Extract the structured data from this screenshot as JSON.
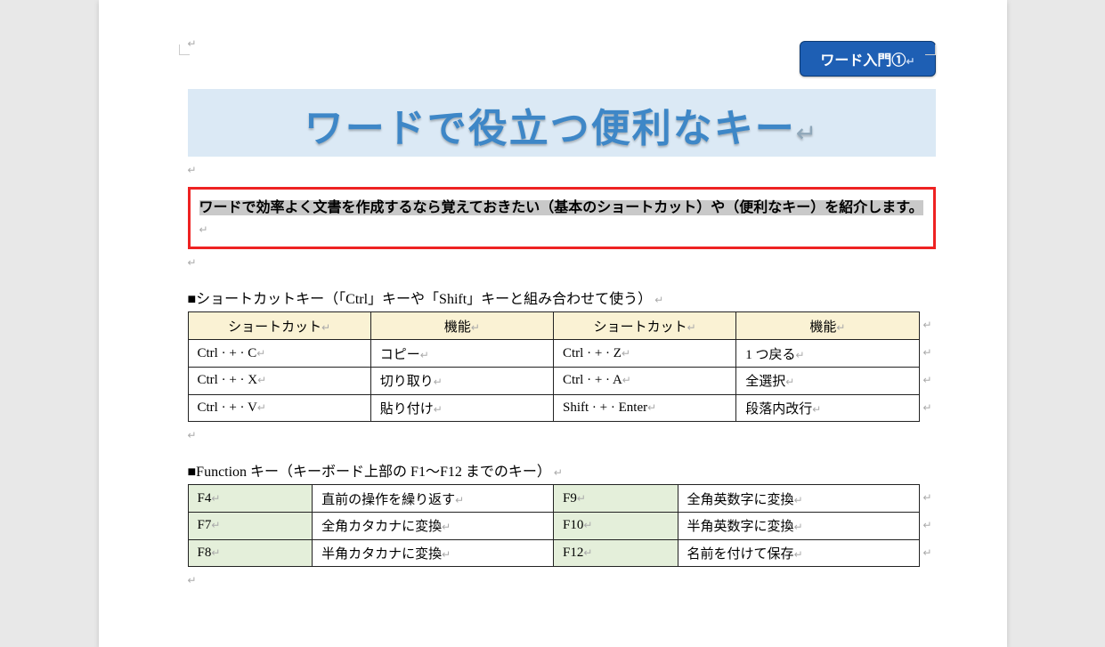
{
  "badge": {
    "label": "ワード入門①"
  },
  "title": "ワードで役立つ便利なキー",
  "intro": "ワードで効率よく文書を作成するなら覚えておきたい（基本のショートカット）や（便利なキー）を紹介します。",
  "section1": {
    "heading": "■ショートカットキー（「Ctrl」キーや「Shift」キーと組み合わせて使う）",
    "headers": [
      "ショートカット",
      "機能",
      "ショートカット",
      "機能"
    ],
    "rows": [
      [
        "Ctrl · + · C",
        "コピー",
        "Ctrl · + · Z",
        "1 つ戻る"
      ],
      [
        "Ctrl · + · X",
        "切り取り",
        "Ctrl · + · A",
        "全選択"
      ],
      [
        "Ctrl · + · V",
        "貼り付け",
        "Shift · + · Enter",
        "段落内改行"
      ]
    ]
  },
  "section2": {
    "heading": "■Function キー（キーボード上部の F1～F12 までのキー）",
    "rows": [
      [
        "F4",
        "直前の操作を繰り返す",
        "F9",
        "全角英数字に変換"
      ],
      [
        "F7",
        "全角カタカナに変換",
        "F10",
        "半角英数字に変換"
      ],
      [
        "F8",
        "半角カタカナに変換",
        "F12",
        "名前を付けて保存"
      ]
    ]
  }
}
